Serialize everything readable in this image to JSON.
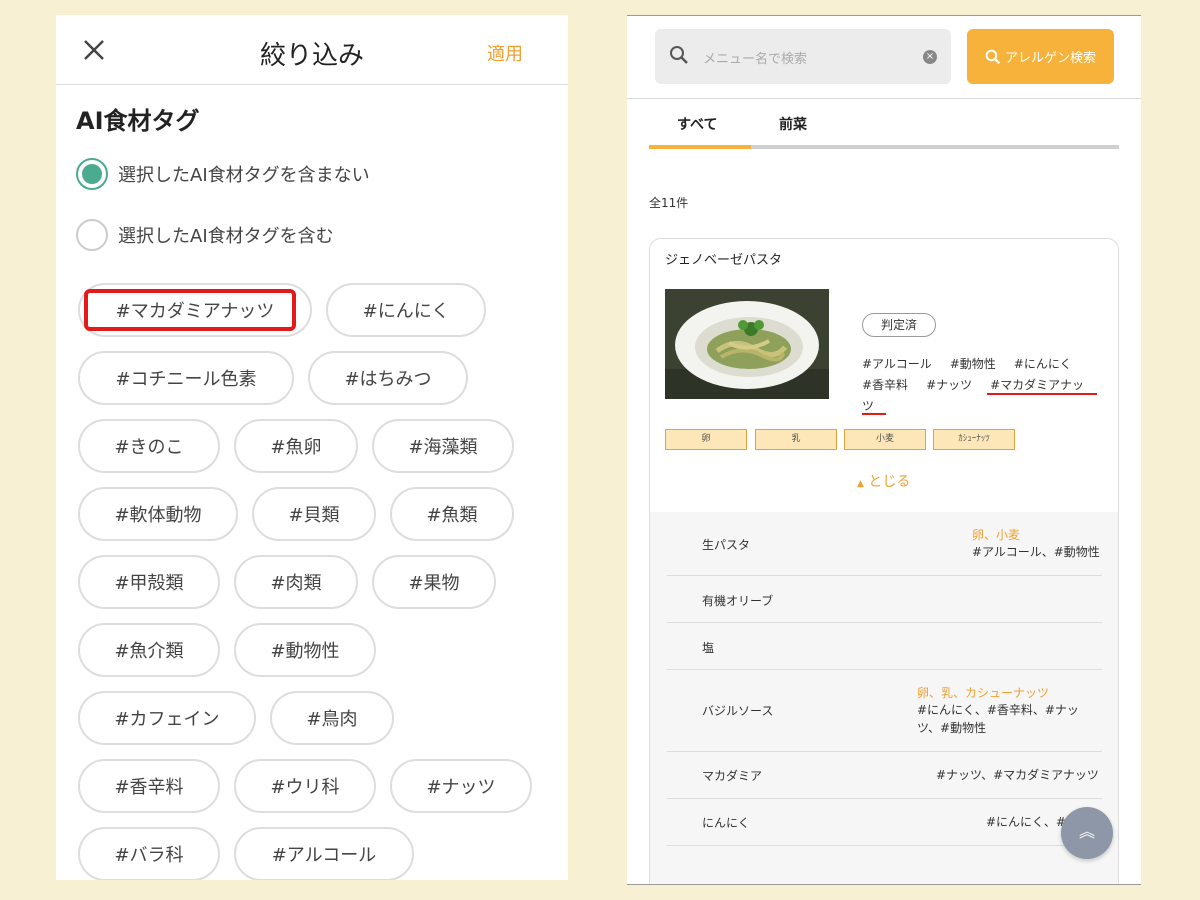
{
  "left": {
    "title": "絞り込み",
    "apply_label": "適用",
    "section_title": "AI食材タグ",
    "radios": [
      {
        "label": "選択したAI食材タグを含まない",
        "selected": true
      },
      {
        "label": "選択したAI食材タグを含む",
        "selected": false
      }
    ],
    "tags": [
      "#マカダミアナッツ",
      "#にんにく",
      "#コチニール色素",
      "#はちみつ",
      "#きのこ",
      "#魚卵",
      "#海藻類",
      "#軟体動物",
      "#貝類",
      "#魚類",
      "#甲殻類",
      "#肉類",
      "#果物",
      "#魚介類",
      "#動物性",
      "#カフェイン",
      "#鳥肉",
      "#香辛料",
      "#ウリ科",
      "#ナッツ",
      "#バラ科",
      "#アルコール"
    ],
    "highlighted_tag": "#マカダミアナッツ"
  },
  "right": {
    "search": {
      "placeholder": "メニュー名で検索"
    },
    "allergy_button": "アレルゲン検索",
    "tabs": [
      "すべて",
      "前菜"
    ],
    "active_tab": "すべて",
    "count": "全11件",
    "card": {
      "name": "ジェノベーゼパスタ",
      "badge": "判定済",
      "tags_line1": [
        "#アルコール",
        "#動物性",
        "#にんにく"
      ],
      "tags_line2": [
        "#香辛料",
        "#ナッツ",
        "#マカダミアナッ"
      ],
      "tags_line3": "ツ",
      "allergens": [
        "卵",
        "乳",
        "小麦",
        "ｶｼｭｰﾅｯﾂ"
      ],
      "toggle_label": "とじる",
      "ingredients": [
        {
          "name": "生パスタ",
          "allergens": "卵、小麦",
          "tags": "#アルコール、#動物性"
        },
        {
          "name": "有機オリーブ",
          "allergens": "",
          "tags": ""
        },
        {
          "name": "塩",
          "allergens": "",
          "tags": ""
        },
        {
          "name": "バジルソース",
          "allergens": "卵、乳、カシューナッツ",
          "tags": "#にんにく、#香辛料、#ナッツ、#動物性"
        },
        {
          "name": "マカダミア",
          "allergens": "",
          "tags": "#ナッツ、#マカダミアナッツ"
        },
        {
          "name": "にんにく",
          "allergens": "",
          "tags": "#にんにく、#"
        }
      ]
    }
  },
  "colors": {
    "accent": "#f7b23b",
    "radio": "#4aab8f",
    "highlight": "#e31a1a"
  },
  "icons": [
    "close-icon",
    "search-icon",
    "clear-icon",
    "caret-up-icon",
    "scroll-top-icon"
  ]
}
